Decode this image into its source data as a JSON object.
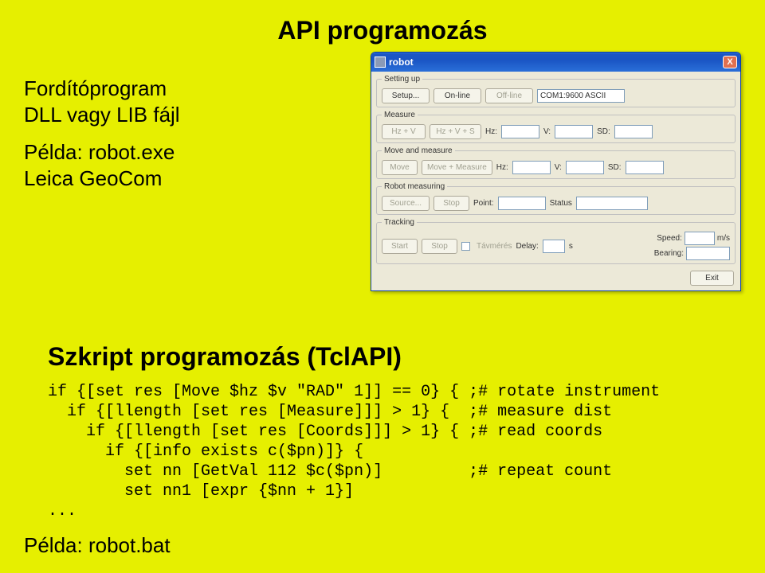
{
  "title": "API programozás",
  "left": {
    "l1": "Fordítóprogram",
    "l2": "DLL vagy LIB fájl",
    "l3": "Példa: robot.exe",
    "l4": "Leica GeoCom"
  },
  "subtitle": "Szkript programozás (TclAPI)",
  "code": "if {[set res [Move $hz $v \"RAD\" 1]] == 0} { ;# rotate instrument\n  if {[llength [set res [Measure]]] > 1} {  ;# measure dist\n    if {[llength [set res [Coords]]] > 1} { ;# read coords\n      if {[info exists c($pn)]} {\n        set nn [GetVal 112 $c($pn)]         ;# repeat count\n        set nn1 [expr {$nn + 1}]\n...",
  "example2": "Példa: robot.bat",
  "win": {
    "title": "robot",
    "close": "X",
    "setup": {
      "legend": "Setting up",
      "setup": "Setup...",
      "online": "On-line",
      "offline": "Off-line",
      "port": "COM1:9600 ASCII"
    },
    "measure": {
      "legend": "Measure",
      "hzv": "Hz + V",
      "hzvs": "Hz + V + S",
      "hz": "Hz:",
      "v": "V:",
      "sd": "SD:"
    },
    "move": {
      "legend": "Move and measure",
      "move": "Move",
      "movem": "Move + Measure",
      "hz": "Hz:",
      "v": "V:",
      "sd": "SD:"
    },
    "robot": {
      "legend": "Robot measuring",
      "source": "Source...",
      "stop": "Stop",
      "point": "Point:",
      "status": "Status"
    },
    "tracking": {
      "legend": "Tracking",
      "start": "Start",
      "stop": "Stop",
      "tav": "Távmérés",
      "delay": "Delay:",
      "s": "s",
      "speed": "Speed:",
      "ms": "m/s",
      "bearing": "Bearing:"
    },
    "exit": "Exit"
  }
}
